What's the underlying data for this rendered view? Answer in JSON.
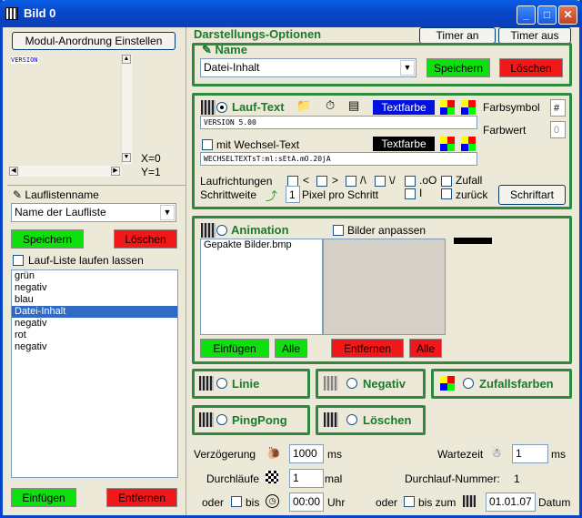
{
  "window": {
    "title": "Bild 0",
    "btn_min": "_",
    "btn_max": "□",
    "btn_close": "✕"
  },
  "left": {
    "modul_btn": "Modul-Anordnung Einstellen",
    "version_tag": "VERSION",
    "x_label": "X=0",
    "y_label": "Y=1",
    "lauflistenname_label": "Lauflistenname",
    "name_combo": "Name der Laufliste",
    "save": "Speichern",
    "delete": "Löschen",
    "run_list_label": "Lauf-Liste laufen lassen",
    "items": [
      "grün",
      "negativ",
      "blau",
      "Datei-Inhalt",
      "negativ",
      "rot",
      "negativ"
    ],
    "insert": "Einfügen",
    "remove": "Entfernen"
  },
  "options": {
    "title": "Darstellungs-Optionen",
    "timer_on": "Timer an",
    "timer_off": "Timer aus",
    "name_label": "Name",
    "name_combo": "Datei-Inhalt",
    "save": "Speichern",
    "delete": "Löschen"
  },
  "lauftext": {
    "label": "Lauf-Text",
    "textfarbe": "Textfarbe",
    "farbsymbol_label": "Farbsymbol",
    "farbsymbol_val": "#",
    "farbwert_label": "Farbwert",
    "farbwert_val": "0",
    "text1": "VERSION 5.00",
    "wechsel_label": "mit Wechsel-Text",
    "textfarbe2": "Textfarbe",
    "text2": "WECHSELTEXTsT:ml:sEtA.mO.20jA",
    "laufrichtungen": "Laufrichtungen",
    "dir1": "<",
    "dir2": ">",
    "dir3": "/\\",
    "dir4": "\\/",
    "dir5": ".oO",
    "dir6": "Zufall",
    "schrittweite": "Schrittweite",
    "schritt_val": "1",
    "pixel_label": "Pixel pro Schritt",
    "dir7": "I",
    "zurueck": "zurück",
    "schriftart": "Schriftart"
  },
  "animation": {
    "label": "Animation",
    "fit_label": "Bilder anpassen",
    "file": "Gepakte Bilder.bmp",
    "insert": "Einfügen",
    "all": "Alle",
    "remove": "Entfernen",
    "all2": "Alle"
  },
  "modes": {
    "linie": "Linie",
    "negativ": "Negativ",
    "zufall": "Zufallsfarben",
    "pingpong": "PingPong",
    "loeschen": "Löschen"
  },
  "timing": {
    "delay_label": "Verzögerung",
    "delay_val": "1000",
    "ms": "ms",
    "wait_label": "Wartezeit",
    "wait_val": "1",
    "ms2": "ms",
    "runs_label": "Durchläufe",
    "runs_val": "1",
    "mal": "mal",
    "run_no_label": "Durchlauf-Nummer:",
    "run_no": "1",
    "oder": "oder",
    "bis": "bis",
    "time_val": "00:00",
    "uhr": "Uhr",
    "oder2": "oder",
    "bis_zum": "bis zum",
    "date_val": "01.01.07",
    "datum": "Datum"
  },
  "colors": {
    "title_bar": "#0846c8",
    "group_border": "#2e8b3e",
    "save_green": "#0de00d",
    "delete_red": "#f01818",
    "select_blue": "#316ac5"
  }
}
